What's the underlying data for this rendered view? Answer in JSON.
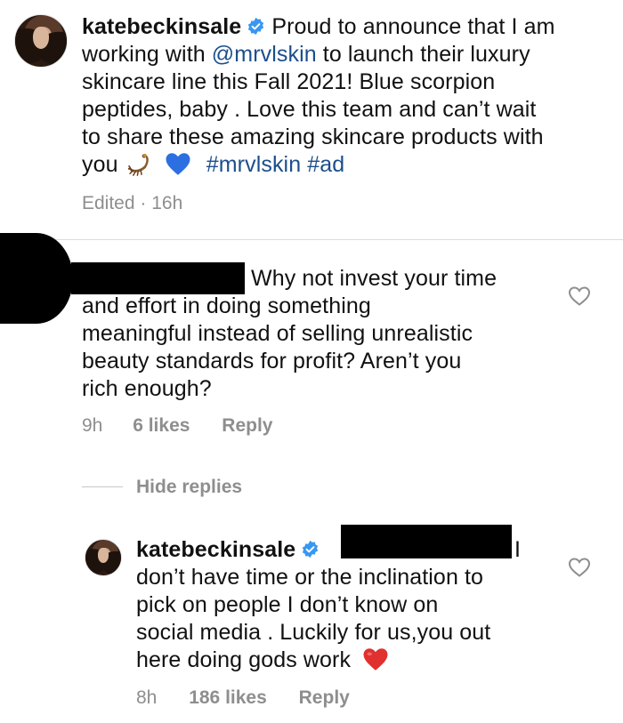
{
  "post": {
    "username": "katebeckinsale",
    "caption_lines": [
      "Proud to announce that I am",
      "working with",
      "@mrvlskin",
      "to launch their luxury",
      "skincare line this Fall 2021! Blue scorpion",
      "peptides, baby . Love this team and can’t wait",
      "to share these amazing skincare products with",
      "you",
      "#mrvlskin #ad"
    ],
    "meta": "Edited · 16h",
    "icons": [
      "verified-badge-icon",
      "scorpion-emoji-icon",
      "blue-heart-emoji-icon"
    ]
  },
  "comment": {
    "text_lines": [
      "Why not invest your time",
      "and effort in doing something",
      "meaningful instead of selling unrealistic",
      "beauty standards for profit? Aren’t you",
      "rich enough?"
    ],
    "time": "9h",
    "likes": "6 likes",
    "reply_label": "Reply",
    "icons": [
      "like-heart-outline-icon"
    ]
  },
  "replies_toggle": "Hide replies",
  "reply": {
    "username": "katebeckinsale",
    "first_line_tail": "I",
    "text_lines": [
      "don’t have time or the inclination  to",
      "pick on people I don’t know on",
      "social media . Luckily for us,you out",
      "here doing gods work"
    ],
    "time": "8h",
    "likes": "186 likes",
    "reply_label": "Reply",
    "icons": [
      "verified-badge-icon",
      "red-heart-emoji-icon",
      "like-heart-outline-icon"
    ]
  },
  "colors": {
    "link_blue": "#1b4f8c",
    "meta_gray": "#8e8e8e",
    "verified_blue": "#3897f0",
    "redaction": "#000000"
  }
}
